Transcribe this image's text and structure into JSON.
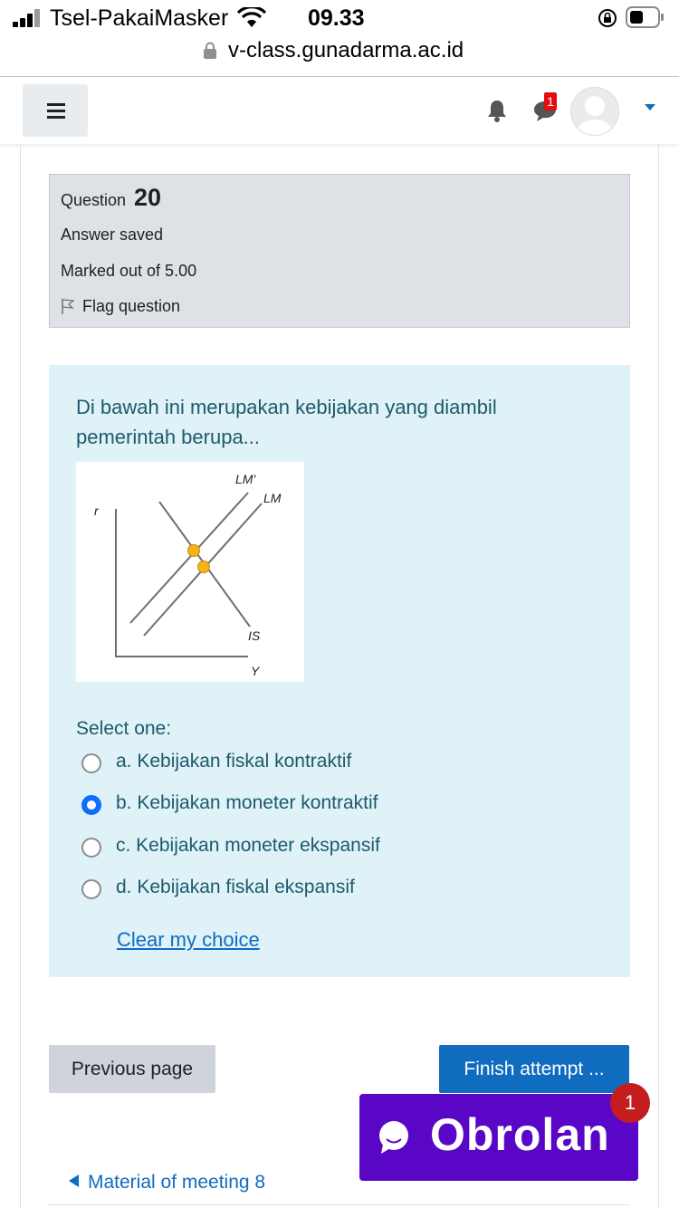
{
  "status_bar": {
    "carrier": "Tsel-PakaiMasker",
    "time": "09.33"
  },
  "browser": {
    "url": "v-class.gunadarma.ac.id"
  },
  "navbar": {
    "message_badge": "1"
  },
  "question_info": {
    "label": "Question",
    "number": "20",
    "state": "Answer saved",
    "grade": "Marked out of 5.00",
    "flag_label": "Flag question"
  },
  "question": {
    "text": "Di bawah ini merupakan kebijakan yang diambil pemerintah berupa...",
    "graph": {
      "y_label": "r",
      "x_label": "Y",
      "curve_labels": [
        "LM'",
        "LM",
        "IS"
      ]
    },
    "select_label": "Select one:",
    "options": [
      {
        "label": "a. Kebijakan fiskal kontraktif",
        "selected": false
      },
      {
        "label": "b. Kebijakan moneter kontraktif",
        "selected": true
      },
      {
        "label": "c. Kebijakan moneter ekspansif",
        "selected": false
      },
      {
        "label": "d. Kebijakan fiskal ekspansif",
        "selected": false
      }
    ],
    "clear_choice": "Clear my choice"
  },
  "navigation": {
    "previous": "Previous page",
    "finish": "Finish attempt ..."
  },
  "chat": {
    "label": "Obrolan",
    "badge": "1"
  },
  "footer": {
    "prev_activity": "Material of meeting 8"
  },
  "colors": {
    "accent": "#0f6cbf",
    "question_bg": "#def2f8",
    "info_bg": "#dee2e6",
    "chat_bg": "#5a06c6",
    "badge_red": "#c31d1d",
    "equilibrium_point": "#f5b21b"
  }
}
